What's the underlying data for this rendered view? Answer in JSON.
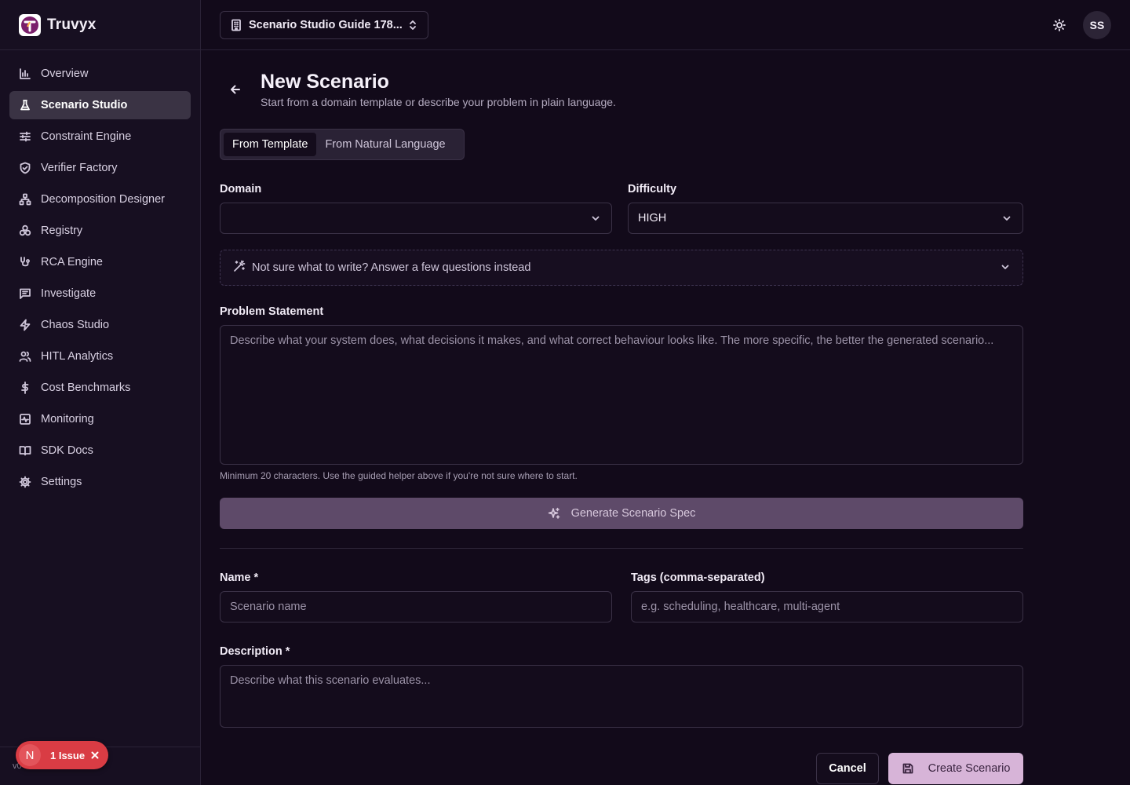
{
  "brand": {
    "name": "Truvyx"
  },
  "sidebar": {
    "items": [
      {
        "label": "Overview",
        "icon": "bar-chart-icon"
      },
      {
        "label": "Scenario Studio",
        "icon": "flask-icon"
      },
      {
        "label": "Constraint Engine",
        "icon": "sliders-icon"
      },
      {
        "label": "Verifier Factory",
        "icon": "shield-check-icon"
      },
      {
        "label": "Decomposition Designer",
        "icon": "network-icon"
      },
      {
        "label": "Registry",
        "icon": "boxes-icon"
      },
      {
        "label": "RCA Engine",
        "icon": "stethoscope-icon"
      },
      {
        "label": "Investigate",
        "icon": "message-icon"
      },
      {
        "label": "Chaos Studio",
        "icon": "zap-icon"
      },
      {
        "label": "HITL Analytics",
        "icon": "users-icon"
      },
      {
        "label": "Cost Benchmarks",
        "icon": "dollar-icon"
      },
      {
        "label": "Monitoring",
        "icon": "activity-icon"
      },
      {
        "label": "SDK Docs",
        "icon": "book-icon"
      },
      {
        "label": "Settings",
        "icon": "gear-icon"
      }
    ],
    "active_index": 1,
    "version_label": "v0"
  },
  "topbar": {
    "workspace": "Scenario Studio Guide 178...",
    "avatar_initials": "SS"
  },
  "page": {
    "title": "New Scenario",
    "subtitle": "Start from a domain template or describe your problem in plain language."
  },
  "mode_tabs": {
    "template": "From Template",
    "natural": "From Natural Language"
  },
  "domain": {
    "label": "Domain",
    "value": ""
  },
  "difficulty": {
    "label": "Difficulty",
    "value": "HIGH"
  },
  "helper": {
    "text": "Not sure what to write? Answer a few questions instead"
  },
  "problem": {
    "label": "Problem Statement",
    "placeholder": "Describe what your system does, what decisions it makes, and what correct behaviour looks like. The more specific, the better the generated scenario...",
    "hint": "Minimum 20 characters. Use the guided helper above if you're not sure where to start."
  },
  "generate": {
    "label": "Generate Scenario Spec"
  },
  "name_field": {
    "label": "Name *",
    "placeholder": "Scenario name"
  },
  "tags_field": {
    "label": "Tags (comma-separated)",
    "placeholder": "e.g. scheduling, healthcare, multi-agent"
  },
  "description_field": {
    "label": "Description *",
    "placeholder": "Describe what this scenario evaluates..."
  },
  "actions": {
    "cancel": "Cancel",
    "create": "Create Scenario"
  },
  "issue": {
    "badge": "N",
    "text": "1 Issue"
  },
  "colors": {
    "accent": "#d7b4d8",
    "error": "#d93c44",
    "background": "#120a1a"
  }
}
